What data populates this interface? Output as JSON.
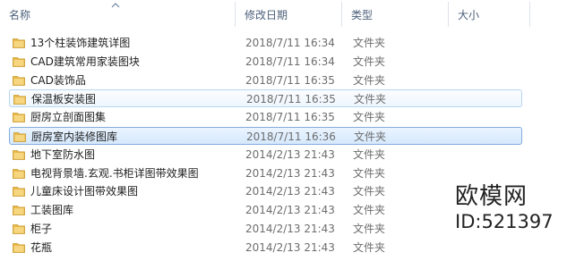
{
  "columns": {
    "name": "名称",
    "date": "修改日期",
    "type": "类型",
    "size": "大小"
  },
  "files": [
    {
      "name": "13个柱装饰建筑详图",
      "date": "2018/7/11 16:34",
      "type": "文件夹"
    },
    {
      "name": "CAD建筑常用家装图块",
      "date": "2018/7/11 16:34",
      "type": "文件夹"
    },
    {
      "name": "CAD装饰品",
      "date": "2018/7/11 16:35",
      "type": "文件夹"
    },
    {
      "name": "保温板安装图",
      "date": "2018/7/11 16:35",
      "type": "文件夹"
    },
    {
      "name": "厨房立剖面图集",
      "date": "2018/7/11 16:35",
      "type": "文件夹"
    },
    {
      "name": "厨房室内装修图库",
      "date": "2018/7/11 16:36",
      "type": "文件夹"
    },
    {
      "name": "地下室防水图",
      "date": "2014/2/13 21:43",
      "type": "文件夹"
    },
    {
      "name": "电视背景墙.玄观.书柜详图带效果图",
      "date": "2014/2/13 21:43",
      "type": "文件夹"
    },
    {
      "name": "儿童床设计图带效果图",
      "date": "2014/2/13 21:43",
      "type": "文件夹"
    },
    {
      "name": "工装图库",
      "date": "2014/2/13 21:43",
      "type": "文件夹"
    },
    {
      "name": "柜子",
      "date": "2014/2/13 21:43",
      "type": "文件夹"
    },
    {
      "name": "花瓶",
      "date": "2014/2/13 21:43",
      "type": "文件夹"
    }
  ],
  "watermark": {
    "logo": "欧模网",
    "id": "ID:521397"
  },
  "colors": {
    "folder": "#e8b84a",
    "selected_border": "#84acdd",
    "hover_border": "#b8d6f0",
    "header_text": "#4c607a"
  },
  "hovered_index": 3,
  "selected_index": 5
}
